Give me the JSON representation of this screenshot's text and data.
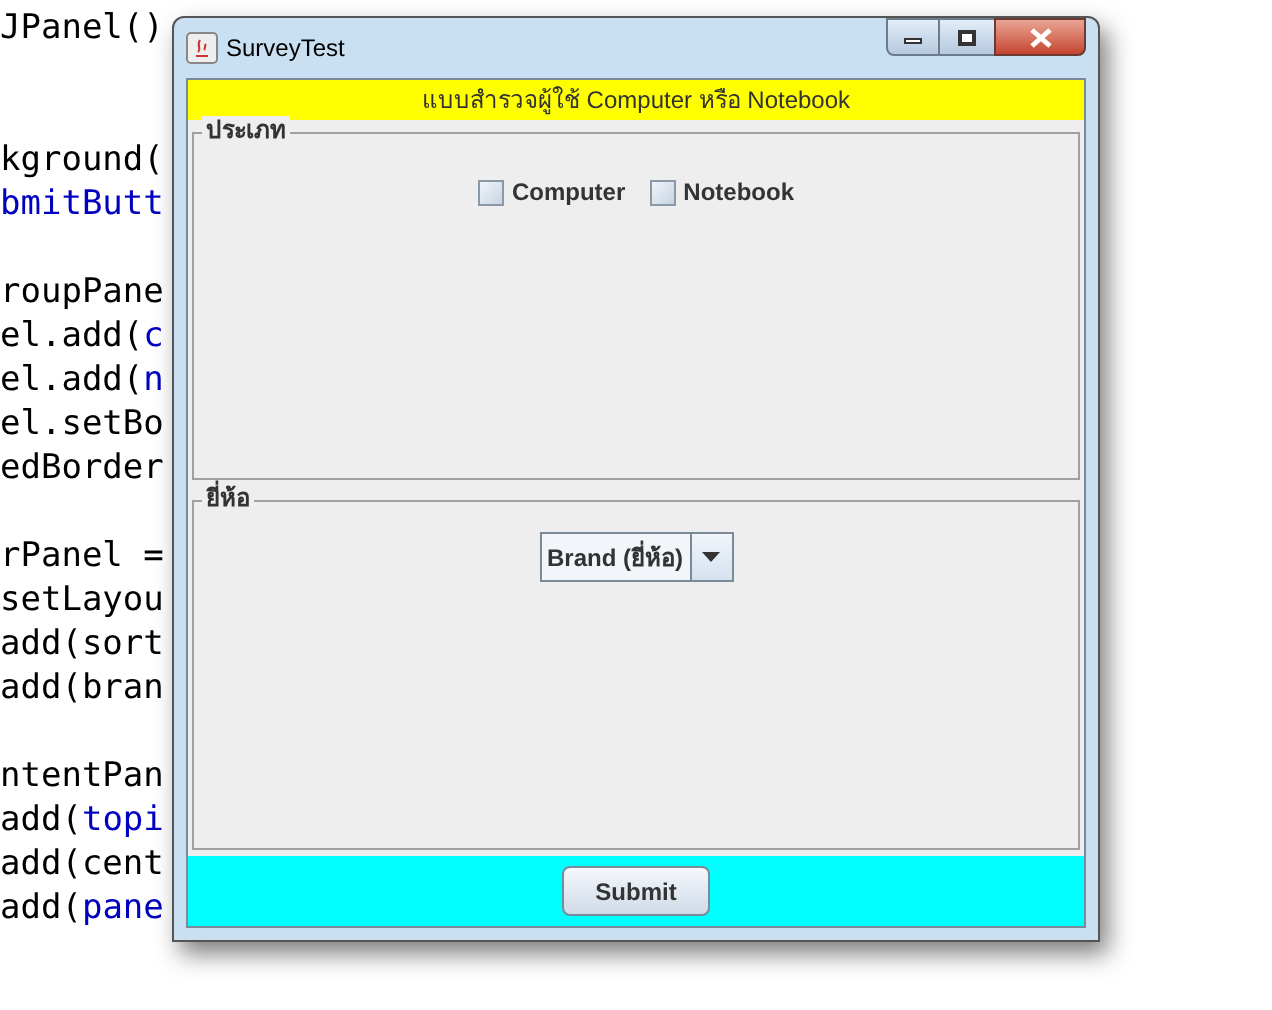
{
  "code_blocks": [
    {
      "lines": [
        [
          {
            "text": "JPanel()",
            "color": "#000000"
          }
        ]
      ]
    },
    {
      "lines": [
        [
          {
            "text": "kground(",
            "color": "#000000"
          }
        ],
        [
          {
            "text": "bmitButt",
            "color": "#0000c0"
          }
        ]
      ]
    },
    {
      "lines": [
        [
          {
            "text": "roupPane",
            "color": "#000000"
          }
        ],
        [
          {
            "text": "el.add(",
            "color": "#000000"
          },
          {
            "text": "c",
            "color": "#0000c0"
          }
        ],
        [
          {
            "text": "el.add(",
            "color": "#000000"
          },
          {
            "text": "n",
            "color": "#0000c0"
          }
        ],
        [
          {
            "text": "el.setBo",
            "color": "#000000"
          }
        ],
        [
          {
            "text": "edBorder",
            "color": "#000000"
          }
        ]
      ]
    },
    {
      "lines": [
        [
          {
            "text": "rPanel =",
            "color": "#000000"
          }
        ],
        [
          {
            "text": "setLayou",
            "color": "#000000"
          }
        ],
        [
          {
            "text": "add(sort",
            "color": "#000000"
          }
        ],
        [
          {
            "text": "add(bran",
            "color": "#000000"
          }
        ]
      ]
    },
    {
      "lines": [
        [
          {
            "text": "ntentPan",
            "color": "#000000"
          }
        ],
        [
          {
            "text": "add(",
            "color": "#000000"
          },
          {
            "text": "topi",
            "color": "#0000c0"
          }
        ],
        [
          {
            "text": "add(cent",
            "color": "#000000"
          }
        ],
        [
          {
            "text": "add(",
            "color": "#000000"
          },
          {
            "text": "pane",
            "color": "#0000c0"
          }
        ]
      ]
    }
  ],
  "window": {
    "title": "SurveyTest"
  },
  "banner": "แบบสำรวจผู้ใช้ Computer หรือ Notebook",
  "type_group": {
    "title": "ประเภท",
    "checkboxes": [
      {
        "label": "Computer",
        "checked": false
      },
      {
        "label": "Notebook",
        "checked": false
      }
    ]
  },
  "brand_group": {
    "title": "ยี่ห้อ",
    "dropdown": {
      "value": "Brand (ยี่ห้อ)"
    }
  },
  "buttons": [
    "Submit"
  ]
}
